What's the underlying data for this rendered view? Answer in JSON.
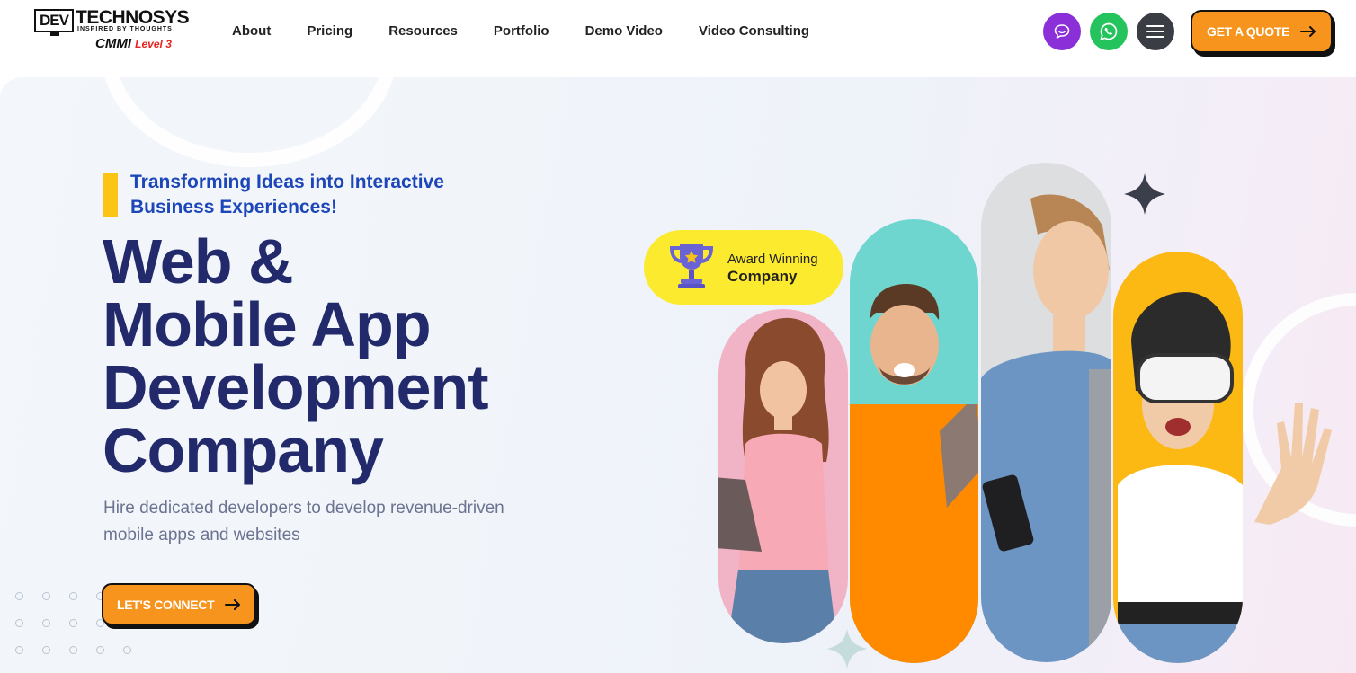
{
  "header": {
    "logo": {
      "dev": "DEV",
      "name": "TECHNOSYS",
      "tagline": "INSPIRED BY THOUGHTS",
      "cmmi": "CMMI",
      "level": "Level 3"
    },
    "nav": [
      {
        "label": "About"
      },
      {
        "label": "Pricing"
      },
      {
        "label": "Resources"
      },
      {
        "label": "Portfolio"
      },
      {
        "label": "Demo Video"
      },
      {
        "label": "Video Consulting"
      }
    ],
    "icons": {
      "chat": "chat-icon",
      "whatsapp": "whatsapp-icon",
      "menu": "hamburger-menu-icon"
    },
    "quote_label": "GET A QUOTE"
  },
  "hero": {
    "subheading": "Transforming Ideas into Interactive Business Experiences!",
    "title_lines": [
      "Web &",
      "Mobile App",
      "Development",
      "Company"
    ],
    "description": "Hire dedicated developers to develop revenue-driven mobile apps and websites",
    "cta_label": "LET'S CONNECT",
    "award": {
      "line1": "Award Winning",
      "line2": "Company"
    }
  },
  "colors": {
    "accent_orange": "#f7941d",
    "title_navy": "#222a6b",
    "subhead_blue": "#1d47b8",
    "accent_yellow": "#fcc414",
    "chat_purple": "#8b2fd9",
    "whatsapp_green": "#25c35d"
  }
}
